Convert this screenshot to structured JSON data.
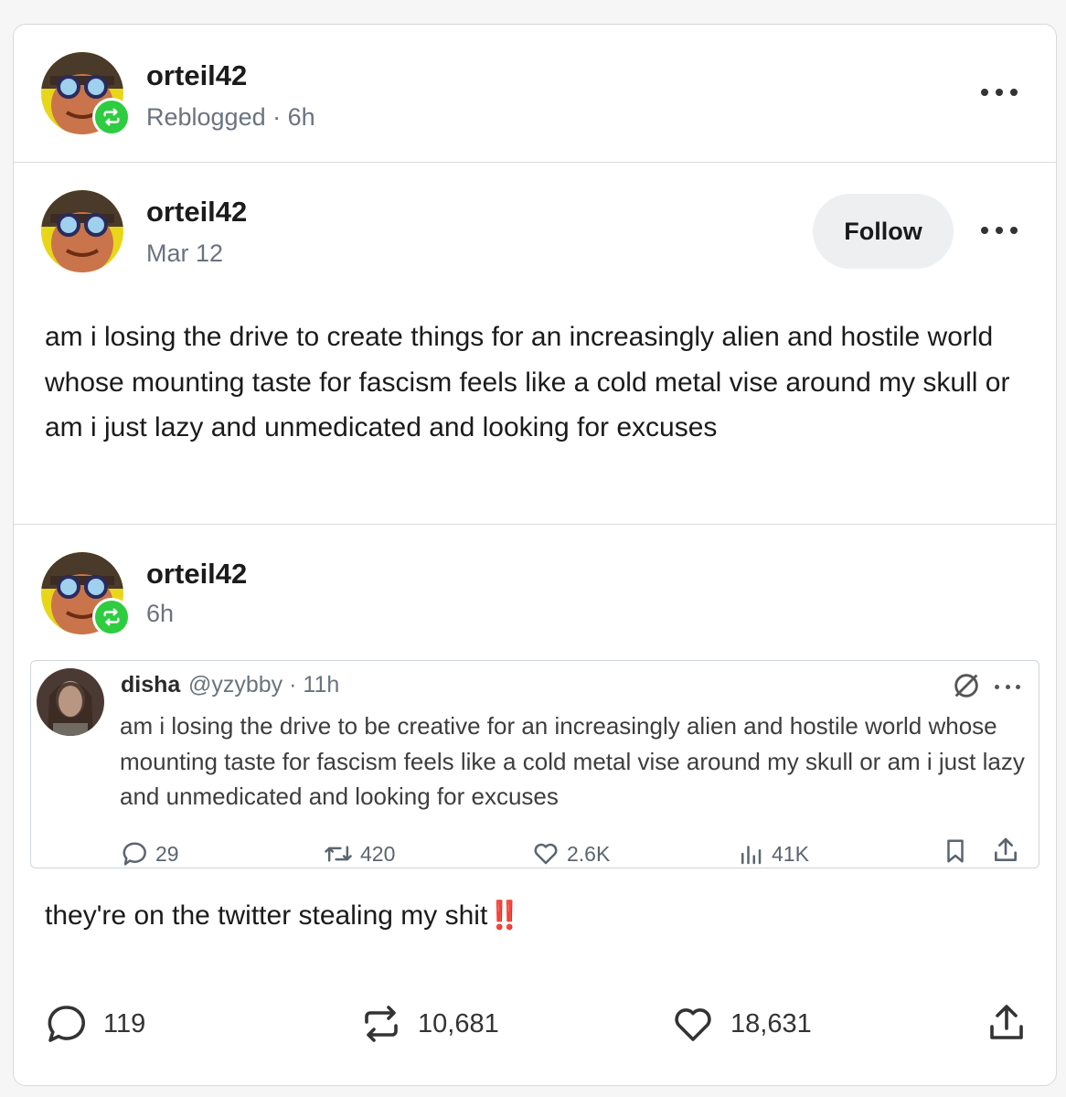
{
  "reblog_header": {
    "username": "orteil42",
    "meta": "Reblogged · 6h",
    "more_label": "more options"
  },
  "post": {
    "username": "orteil42",
    "date": "Mar 12",
    "follow_label": "Follow",
    "body": "am i losing the drive to create things for an increasingly alien and hostile world whose mounting taste for fascism feels like a cold metal vise around my skull or am i just lazy and unmedicated and looking for excuses"
  },
  "reblog": {
    "username": "orteil42",
    "time": "6h",
    "caption": "they're on the twitter stealing my shit",
    "caption_emoji": "‼️"
  },
  "quoted_tweet": {
    "name": "disha",
    "handle": "@yzybby · 11h",
    "text": "am i losing the drive to be creative for an increasingly alien and hostile world whose mounting taste for fascism feels like a cold metal vise around my skull or am i just lazy and unmedicated and looking for excuses",
    "replies": "29",
    "retweets": "420",
    "likes": "2.6K",
    "views": "41K"
  },
  "footer": {
    "comments": "119",
    "reblogs": "10,681",
    "likes": "18,631"
  },
  "colors": {
    "badge": "#2ecc40",
    "divider": "#dcdcdc",
    "meta_text": "#6b7280",
    "follow_bg": "#eeeff1",
    "emoji_red": "#e0202e"
  }
}
